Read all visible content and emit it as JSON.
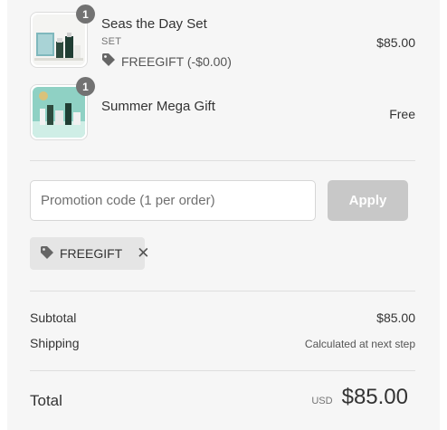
{
  "items": [
    {
      "name": "Seas the Day Set",
      "variant": "SET",
      "discount": "FREEGIFT (-$0.00)",
      "price": "$85.00",
      "quantity": "1"
    },
    {
      "name": "Summer Mega Gift",
      "price": "Free",
      "quantity": "1"
    }
  ],
  "promo": {
    "placeholder": "Promotion code (1 per order)",
    "apply_label": "Apply"
  },
  "applied_code": "FREEGIFT",
  "summary": {
    "subtotal_label": "Subtotal",
    "subtotal_value": "$85.00",
    "shipping_label": "Shipping",
    "shipping_value": "Calculated at next step"
  },
  "total": {
    "label": "Total",
    "currency": "USD",
    "amount": "$85.00"
  },
  "colors": {
    "panel_bg": "#f6f6f6",
    "apply_disabled": "#c8c8c8",
    "chip_bg": "#e5e5e5",
    "badge": "#727272"
  }
}
